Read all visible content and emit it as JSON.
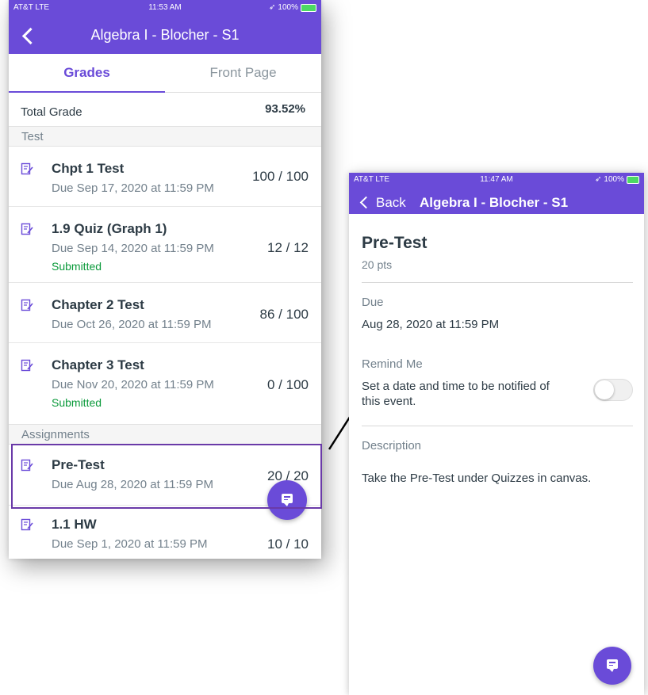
{
  "colors": {
    "brand": "#6a4bd8",
    "submitted": "#0b9a3b",
    "highlight": "#6a3aa8"
  },
  "left": {
    "status": {
      "carrier": "AT&T  LTE",
      "time": "11:53 AM",
      "battery": "100%"
    },
    "nav": {
      "title": "Algebra I - Blocher - S1",
      "back_icon": "chevron-left-icon"
    },
    "tabs": [
      {
        "label": "Grades",
        "active": true
      },
      {
        "label": "Front Page",
        "active": false
      }
    ],
    "total": {
      "label": "Total Grade",
      "value": "93.52%"
    },
    "sections": [
      {
        "header": "Test",
        "items": [
          {
            "title": "Chpt 1 Test",
            "due": "Due Sep 17, 2020 at 11:59 PM",
            "score": "100 / 100",
            "status": ""
          },
          {
            "title": "1.9 Quiz (Graph 1)",
            "due": "Due Sep 14, 2020 at 11:59 PM",
            "score": "12 / 12",
            "status": "Submitted"
          },
          {
            "title": "Chapter 2 Test",
            "due": "Due Oct 26, 2020 at 11:59 PM",
            "score": "86 / 100",
            "status": ""
          },
          {
            "title": "Chapter 3 Test",
            "due": "Due Nov 20, 2020 at 11:59 PM",
            "score": "0 / 100",
            "status": "Submitted"
          }
        ]
      },
      {
        "header": "Assignments",
        "items": [
          {
            "title": "Pre-Test",
            "due": "Due Aug 28, 2020 at 11:59 PM",
            "score": "20 / 20",
            "status": ""
          },
          {
            "title": "1.1 HW",
            "due": "Due Sep 1, 2020 at 11:59 PM",
            "score": "10 / 10",
            "status": ""
          }
        ]
      }
    ],
    "fab_icon": "chat-icon"
  },
  "right": {
    "status": {
      "carrier": "AT&T  LTE",
      "time": "11:47 AM",
      "battery": "100%"
    },
    "nav": {
      "back": "Back",
      "title": "Algebra I - Blocher - S1"
    },
    "detail": {
      "title": "Pre-Test",
      "points": "20 pts",
      "due_label": "Due",
      "due_value": "Aug 28, 2020 at 11:59 PM",
      "remind_label": "Remind Me",
      "remind_text_1": "Set a date and time to be notified of",
      "remind_text_2": "this event.",
      "remind_on": false,
      "description_label": "Description",
      "description": "Take the Pre-Test under Quizzes in canvas."
    },
    "fab_icon": "chat-icon"
  }
}
